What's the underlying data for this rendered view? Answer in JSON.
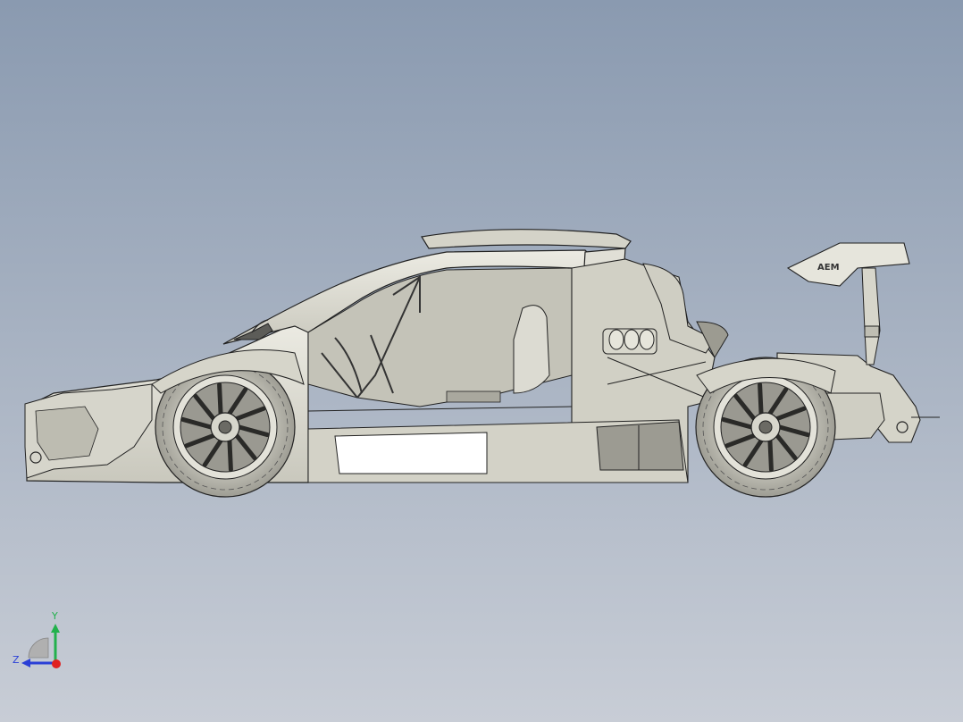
{
  "viewport": {
    "background_top": "#8a9ab0",
    "background_bottom": "#c8cdd6"
  },
  "model": {
    "body_color": "#d9d8cf",
    "shade_color": "#b9b8ac",
    "dark_color": "#6a6a66",
    "edge_color": "#222222",
    "glass_color": "#ffffff",
    "wing_badge": "AEM"
  },
  "triad": {
    "y_label": "Y",
    "z_label": "Z",
    "y_color": "#22b14c",
    "z_color": "#2a3fd6",
    "x_color": "#e02020"
  }
}
